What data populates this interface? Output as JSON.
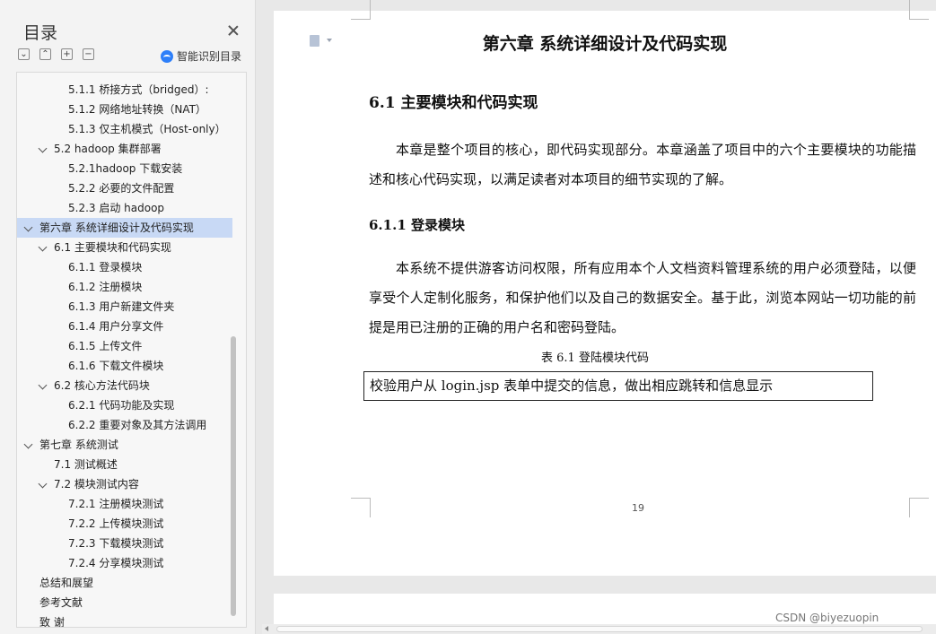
{
  "sidebar": {
    "title": "目录",
    "tools": [
      "⌄",
      "⌃",
      "+",
      "−"
    ],
    "smart_toc_label": "智能识别目录",
    "toc": [
      {
        "label": "5.1.1 桥接方式（bridged）:",
        "level": 3,
        "expanded": false,
        "active": false
      },
      {
        "label": "5.1.2 网络地址转换（NAT）",
        "level": 3,
        "expanded": false,
        "active": false
      },
      {
        "label": "5.1.3 仅主机模式（Host-only）",
        "level": 3,
        "expanded": false,
        "active": false
      },
      {
        "label": "5.2 hadoop 集群部署",
        "level": 2,
        "expanded": true,
        "active": false
      },
      {
        "label": "5.2.1hadoop 下载安装",
        "level": 3,
        "expanded": false,
        "active": false
      },
      {
        "label": "5.2.2 必要的文件配置",
        "level": 3,
        "expanded": false,
        "active": false
      },
      {
        "label": "5.2.3 启动 hadoop",
        "level": 3,
        "expanded": false,
        "active": false
      },
      {
        "label": "第六章 系统详细设计及代码实现",
        "level": 1,
        "expanded": true,
        "active": true
      },
      {
        "label": "6.1 主要模块和代码实现",
        "level": 2,
        "expanded": true,
        "active": false
      },
      {
        "label": "6.1.1 登录模块",
        "level": 3,
        "expanded": false,
        "active": false
      },
      {
        "label": "6.1.2 注册模块",
        "level": 3,
        "expanded": false,
        "active": false
      },
      {
        "label": "6.1.3 用户新建文件夹",
        "level": 3,
        "expanded": false,
        "active": false
      },
      {
        "label": "6.1.4 用户分享文件",
        "level": 3,
        "expanded": false,
        "active": false
      },
      {
        "label": "6.1.5 上传文件",
        "level": 3,
        "expanded": false,
        "active": false
      },
      {
        "label": "6.1.6 下载文件模块",
        "level": 3,
        "expanded": false,
        "active": false
      },
      {
        "label": "6.2 核心方法代码块",
        "level": 2,
        "expanded": true,
        "active": false
      },
      {
        "label": "6.2.1 代码功能及实现",
        "level": 3,
        "expanded": false,
        "active": false
      },
      {
        "label": "6.2.2 重要对象及其方法调用",
        "level": 3,
        "expanded": false,
        "active": false
      },
      {
        "label": "第七章 系统测试",
        "level": 1,
        "expanded": true,
        "active": false
      },
      {
        "label": "7.1 测试概述",
        "level": 2,
        "expanded": false,
        "active": false
      },
      {
        "label": "7.2 模块测试内容",
        "level": 2,
        "expanded": true,
        "active": false
      },
      {
        "label": "7.2.1 注册模块测试",
        "level": 3,
        "expanded": false,
        "active": false
      },
      {
        "label": "7.2.2 上传模块测试",
        "level": 3,
        "expanded": false,
        "active": false
      },
      {
        "label": "7.2.3 下载模块测试",
        "level": 3,
        "expanded": false,
        "active": false
      },
      {
        "label": "7.2.4 分享模块测试",
        "level": 3,
        "expanded": false,
        "active": false
      },
      {
        "label": "总结和展望",
        "level": 1,
        "expanded": false,
        "active": false
      },
      {
        "label": "参考文献",
        "level": 1,
        "expanded": false,
        "active": false
      },
      {
        "label": "致 谢",
        "level": 1,
        "expanded": false,
        "active": false
      }
    ]
  },
  "document": {
    "chapter_title": "第六章 系统详细设计及代码实现",
    "section_title": "6.1 主要模块和代码实现",
    "section_paragraph": "本章是整个项目的核心，即代码实现部分。本章涵盖了项目中的六个主要模块的功能描述和核心代码实现，以满足读者对本项目的细节实现的了解。",
    "subsection_title": "6.1.1 登录模块",
    "subsection_paragraph": "本系统不提供游客访问权限，所有应用本个人文档资料管理系统的用户必须登陆，以便享受个人定制化服务，和保护他们以及自己的数据安全。基于此，浏览本网站一切功能的前提是用已注册的正确的用户名和密码登陆。",
    "table_caption": "表 6.1 登陆模块代码",
    "code_box_text": "校验用户从 login.jsp 表单中提交的信息，做出相应跳转和信息显示",
    "page_number": "19"
  },
  "watermark": "CSDN @biyezuopin"
}
